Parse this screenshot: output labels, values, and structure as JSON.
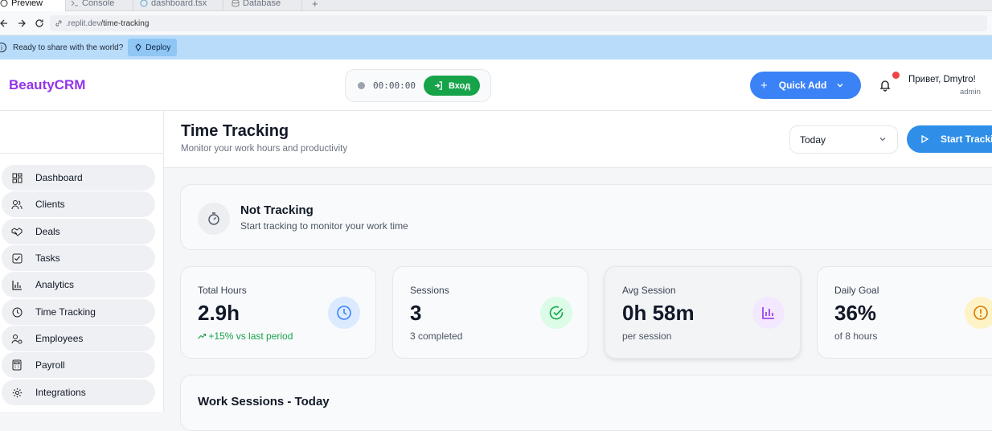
{
  "browser": {
    "tabs": [
      {
        "label": "Preview"
      },
      {
        "label": "Console"
      },
      {
        "label": "dashboard.tsx"
      },
      {
        "label": "Database"
      }
    ],
    "new_tab": "+",
    "url_host": ".replit.dev",
    "url_path": "/time-tracking"
  },
  "banner": {
    "message": "Ready to share with the world?",
    "deploy_label": "Deploy"
  },
  "header": {
    "brand": "BeautyCRM",
    "timer": "00:00:00",
    "checkin_label": "Вход",
    "quick_add_label": "Quick Add",
    "greeting": "Привет, Dmytro!",
    "role": "admin",
    "colors": {
      "brand": "#9333ea",
      "accent": "#3b82f6",
      "success": "#16a34a",
      "badge": "#ef4444"
    }
  },
  "sidebar": {
    "items": [
      {
        "label": "Dashboard",
        "icon": "grid-icon"
      },
      {
        "label": "Clients",
        "icon": "users-icon"
      },
      {
        "label": "Deals",
        "icon": "handshake-icon"
      },
      {
        "label": "Tasks",
        "icon": "checkbox-icon"
      },
      {
        "label": "Analytics",
        "icon": "bar-chart-icon"
      },
      {
        "label": "Time Tracking",
        "icon": "clock-icon"
      },
      {
        "label": "Employees",
        "icon": "user-cog-icon"
      },
      {
        "label": "Payroll",
        "icon": "calculator-icon"
      },
      {
        "label": "Integrations",
        "icon": "gear-icon"
      }
    ]
  },
  "page": {
    "title": "Time Tracking",
    "subtitle": "Monitor your work hours and productivity",
    "period": "Today",
    "start_label": "Start Tracking"
  },
  "status": {
    "title": "Not Tracking",
    "subtitle": "Start tracking to monitor your work time"
  },
  "stats": [
    {
      "label": "Total Hours",
      "value": "2.9h",
      "sub": "+15% vs last period",
      "icon": "clock-icon"
    },
    {
      "label": "Sessions",
      "value": "3",
      "sub": "3 completed",
      "icon": "check-circle-icon"
    },
    {
      "label": "Avg Session",
      "value": "0h 58m",
      "sub": "per session",
      "icon": "bar-chart-icon"
    },
    {
      "label": "Daily Goal",
      "value": "36%",
      "sub": "of 8 hours",
      "icon": "alert-circle-icon"
    }
  ],
  "sessions": {
    "title": "Work Sessions - Today"
  }
}
